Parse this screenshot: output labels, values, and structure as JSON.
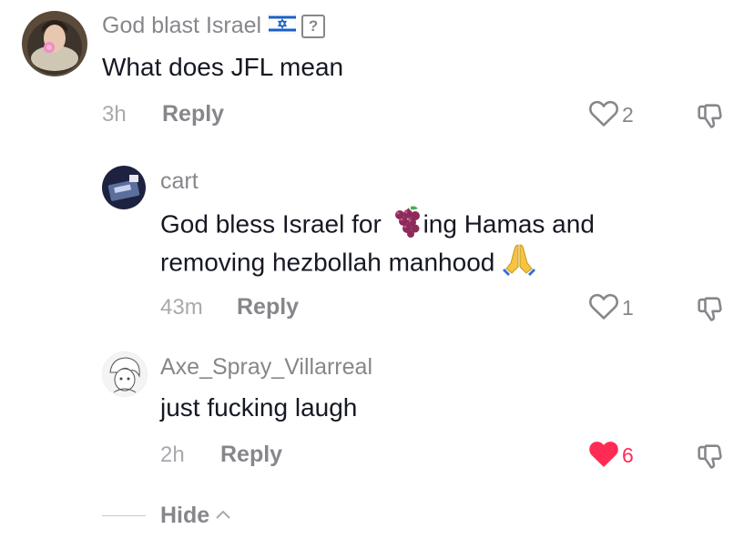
{
  "comments": [
    {
      "username": "God blast Israel",
      "flag_icon": "israel-flag-icon",
      "badge_char": "?",
      "text": "What does JFL mean",
      "time": "3h",
      "reply_label": "Reply",
      "likes": "2",
      "liked": false
    },
    {
      "username": "cart",
      "text_line1_a": "God bless Israel for ",
      "text_line1_emoji": "grapes-emoji",
      "text_line1_b": "ing Hamas and",
      "text_line2": "removing hezbollah manhood ",
      "text_line2_emoji": "folded-hands-emoji",
      "time": "43m",
      "reply_label": "Reply",
      "likes": "1",
      "liked": false
    },
    {
      "username": "Axe_Spray_Villarreal",
      "text": "just fucking laugh",
      "time": "2h",
      "reply_label": "Reply",
      "likes": "6",
      "liked": true
    }
  ],
  "hide_label": "Hide",
  "colors": {
    "like_active": "#fe2c55",
    "meta": "#86878b",
    "text": "#161823"
  }
}
